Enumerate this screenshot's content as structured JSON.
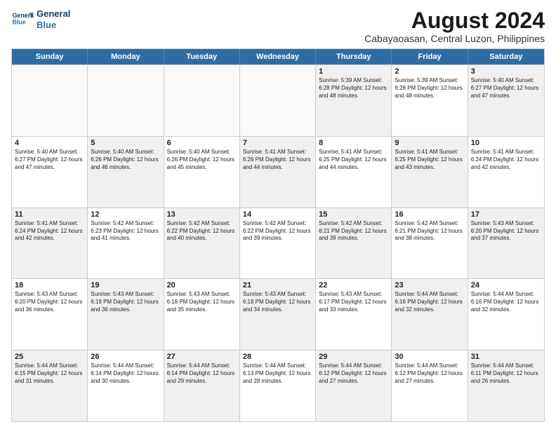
{
  "header": {
    "logo_line1": "General",
    "logo_line2": "Blue",
    "month_year": "August 2024",
    "location": "Cabayaoasan, Central Luzon, Philippines"
  },
  "days_of_week": [
    "Sunday",
    "Monday",
    "Tuesday",
    "Wednesday",
    "Thursday",
    "Friday",
    "Saturday"
  ],
  "weeks": [
    [
      {
        "day": "",
        "info": "",
        "empty": true
      },
      {
        "day": "",
        "info": "",
        "empty": true
      },
      {
        "day": "",
        "info": "",
        "empty": true
      },
      {
        "day": "",
        "info": "",
        "empty": true
      },
      {
        "day": "1",
        "info": "Sunrise: 5:39 AM\nSunset: 6:28 PM\nDaylight: 12 hours\nand 48 minutes.",
        "shaded": true
      },
      {
        "day": "2",
        "info": "Sunrise: 5:39 AM\nSunset: 6:28 PM\nDaylight: 12 hours\nand 48 minutes.",
        "shaded": false
      },
      {
        "day": "3",
        "info": "Sunrise: 5:40 AM\nSunset: 6:27 PM\nDaylight: 12 hours\nand 47 minutes.",
        "shaded": true
      }
    ],
    [
      {
        "day": "4",
        "info": "Sunrise: 5:40 AM\nSunset: 6:27 PM\nDaylight: 12 hours\nand 47 minutes.",
        "shaded": false
      },
      {
        "day": "5",
        "info": "Sunrise: 5:40 AM\nSunset: 6:26 PM\nDaylight: 12 hours\nand 46 minutes.",
        "shaded": true
      },
      {
        "day": "6",
        "info": "Sunrise: 5:40 AM\nSunset: 6:26 PM\nDaylight: 12 hours\nand 45 minutes.",
        "shaded": false
      },
      {
        "day": "7",
        "info": "Sunrise: 5:41 AM\nSunset: 6:26 PM\nDaylight: 12 hours\nand 44 minutes.",
        "shaded": true
      },
      {
        "day": "8",
        "info": "Sunrise: 5:41 AM\nSunset: 6:25 PM\nDaylight: 12 hours\nand 44 minutes.",
        "shaded": false
      },
      {
        "day": "9",
        "info": "Sunrise: 5:41 AM\nSunset: 6:25 PM\nDaylight: 12 hours\nand 43 minutes.",
        "shaded": true
      },
      {
        "day": "10",
        "info": "Sunrise: 5:41 AM\nSunset: 6:24 PM\nDaylight: 12 hours\nand 42 minutes.",
        "shaded": false
      }
    ],
    [
      {
        "day": "11",
        "info": "Sunrise: 5:41 AM\nSunset: 6:24 PM\nDaylight: 12 hours\nand 42 minutes.",
        "shaded": true
      },
      {
        "day": "12",
        "info": "Sunrise: 5:42 AM\nSunset: 6:23 PM\nDaylight: 12 hours\nand 41 minutes.",
        "shaded": false
      },
      {
        "day": "13",
        "info": "Sunrise: 5:42 AM\nSunset: 6:22 PM\nDaylight: 12 hours\nand 40 minutes.",
        "shaded": true
      },
      {
        "day": "14",
        "info": "Sunrise: 5:42 AM\nSunset: 6:22 PM\nDaylight: 12 hours\nand 39 minutes.",
        "shaded": false
      },
      {
        "day": "15",
        "info": "Sunrise: 5:42 AM\nSunset: 6:21 PM\nDaylight: 12 hours\nand 39 minutes.",
        "shaded": true
      },
      {
        "day": "16",
        "info": "Sunrise: 5:42 AM\nSunset: 6:21 PM\nDaylight: 12 hours\nand 38 minutes.",
        "shaded": false
      },
      {
        "day": "17",
        "info": "Sunrise: 5:43 AM\nSunset: 6:20 PM\nDaylight: 12 hours\nand 37 minutes.",
        "shaded": true
      }
    ],
    [
      {
        "day": "18",
        "info": "Sunrise: 5:43 AM\nSunset: 6:20 PM\nDaylight: 12 hours\nand 36 minutes.",
        "shaded": false
      },
      {
        "day": "19",
        "info": "Sunrise: 5:43 AM\nSunset: 6:19 PM\nDaylight: 12 hours\nand 36 minutes.",
        "shaded": true
      },
      {
        "day": "20",
        "info": "Sunrise: 5:43 AM\nSunset: 6:18 PM\nDaylight: 12 hours\nand 35 minutes.",
        "shaded": false
      },
      {
        "day": "21",
        "info": "Sunrise: 5:43 AM\nSunset: 6:18 PM\nDaylight: 12 hours\nand 34 minutes.",
        "shaded": true
      },
      {
        "day": "22",
        "info": "Sunrise: 5:43 AM\nSunset: 6:17 PM\nDaylight: 12 hours\nand 33 minutes.",
        "shaded": false
      },
      {
        "day": "23",
        "info": "Sunrise: 5:44 AM\nSunset: 6:16 PM\nDaylight: 12 hours\nand 32 minutes.",
        "shaded": true
      },
      {
        "day": "24",
        "info": "Sunrise: 5:44 AM\nSunset: 6:16 PM\nDaylight: 12 hours\nand 32 minutes.",
        "shaded": false
      }
    ],
    [
      {
        "day": "25",
        "info": "Sunrise: 5:44 AM\nSunset: 6:15 PM\nDaylight: 12 hours\nand 31 minutes.",
        "shaded": true
      },
      {
        "day": "26",
        "info": "Sunrise: 5:44 AM\nSunset: 6:14 PM\nDaylight: 12 hours\nand 30 minutes.",
        "shaded": false
      },
      {
        "day": "27",
        "info": "Sunrise: 5:44 AM\nSunset: 6:14 PM\nDaylight: 12 hours\nand 29 minutes.",
        "shaded": true
      },
      {
        "day": "28",
        "info": "Sunrise: 5:44 AM\nSunset: 6:13 PM\nDaylight: 12 hours\nand 28 minutes.",
        "shaded": false
      },
      {
        "day": "29",
        "info": "Sunrise: 5:44 AM\nSunset: 6:12 PM\nDaylight: 12 hours\nand 27 minutes.",
        "shaded": true
      },
      {
        "day": "30",
        "info": "Sunrise: 5:44 AM\nSunset: 6:12 PM\nDaylight: 12 hours\nand 27 minutes.",
        "shaded": false
      },
      {
        "day": "31",
        "info": "Sunrise: 5:44 AM\nSunset: 6:11 PM\nDaylight: 12 hours\nand 26 minutes.",
        "shaded": true
      }
    ]
  ]
}
